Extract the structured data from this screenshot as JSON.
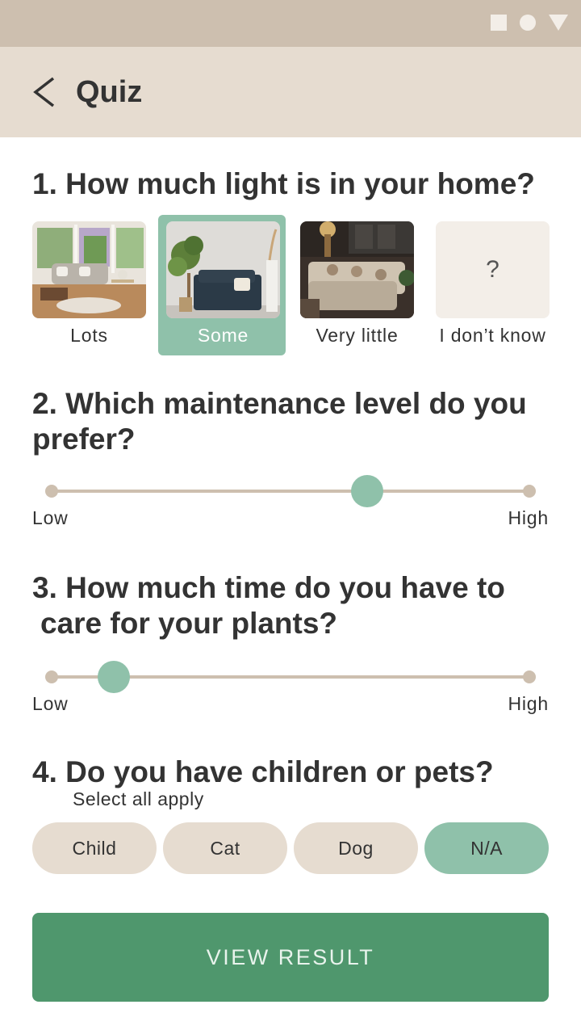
{
  "app_bar": {
    "title": "Quiz"
  },
  "questions": {
    "q1": {
      "text": "1. How much light is in your home?"
    },
    "q2": {
      "text": "2. Which maintenance level do you prefer?"
    },
    "q3": {
      "line1": "3. How much time do you have to",
      "line2": "care for your plants?"
    },
    "q4": {
      "text": "4. Do you have children or pets?",
      "hint": "Select all apply"
    }
  },
  "light_options": [
    {
      "label": "Lots",
      "icon": "bright-living-room-image",
      "selected": false
    },
    {
      "label": "Some",
      "icon": "medium-light-room-image",
      "selected": true
    },
    {
      "label": "Very little",
      "icon": "dim-living-room-image",
      "selected": false
    },
    {
      "label": "I don’t know",
      "glyph": "?",
      "selected": false
    }
  ],
  "maintenance_slider": {
    "low_label": "Low",
    "high_label": "High",
    "value": 0.66
  },
  "time_slider": {
    "low_label": "Low",
    "high_label": "High",
    "value": 0.13
  },
  "household_chips": [
    {
      "label": "Child",
      "selected": false
    },
    {
      "label": "Cat",
      "selected": false
    },
    {
      "label": "Dog",
      "selected": false
    },
    {
      "label": "N/A",
      "selected": true
    }
  ],
  "cta": {
    "label": "VIEW RESULT"
  },
  "colors": {
    "status_bar": "#cdbfaf",
    "app_bar": "#e6dcd0",
    "accent": "#8fc1aa",
    "primary_button": "#4f976d",
    "chip": "#e6dcd0"
  }
}
